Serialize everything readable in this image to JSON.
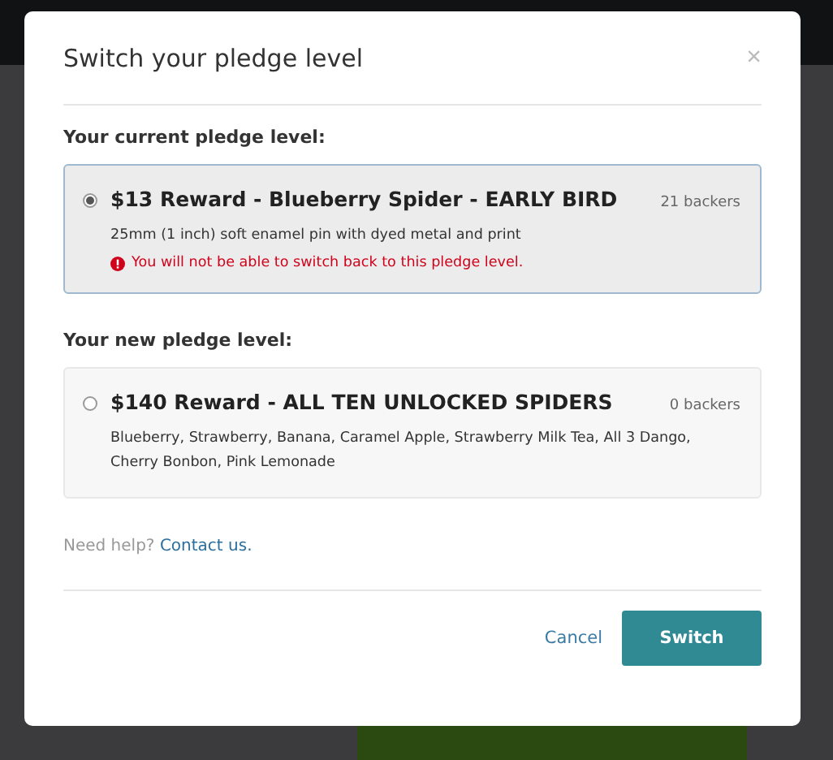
{
  "dialog": {
    "title": "Switch your pledge level",
    "close": "×"
  },
  "current_section": {
    "heading": "Your current pledge level:",
    "reward": {
      "title": "$13 Reward - Blueberry Spider - EARLY BIRD",
      "backers": "21 backers",
      "description": "25mm (1 inch) soft enamel pin with dyed metal and print",
      "warning": "You will not be able to switch back to this pledge level.",
      "selected": true
    }
  },
  "new_section": {
    "heading": "Your new pledge level:",
    "reward": {
      "title": "$140 Reward - ALL TEN UNLOCKED SPIDERS",
      "backers": "0 backers",
      "description": "Blueberry, Strawberry, Banana, Caramel Apple, Strawberry Milk Tea, All 3 Dango, Cherry Bonbon, Pink Lemonade",
      "selected": false
    }
  },
  "help": {
    "text": "Need help?",
    "link": "Contact us."
  },
  "buttons": {
    "cancel": "Cancel",
    "confirm": "Switch"
  }
}
